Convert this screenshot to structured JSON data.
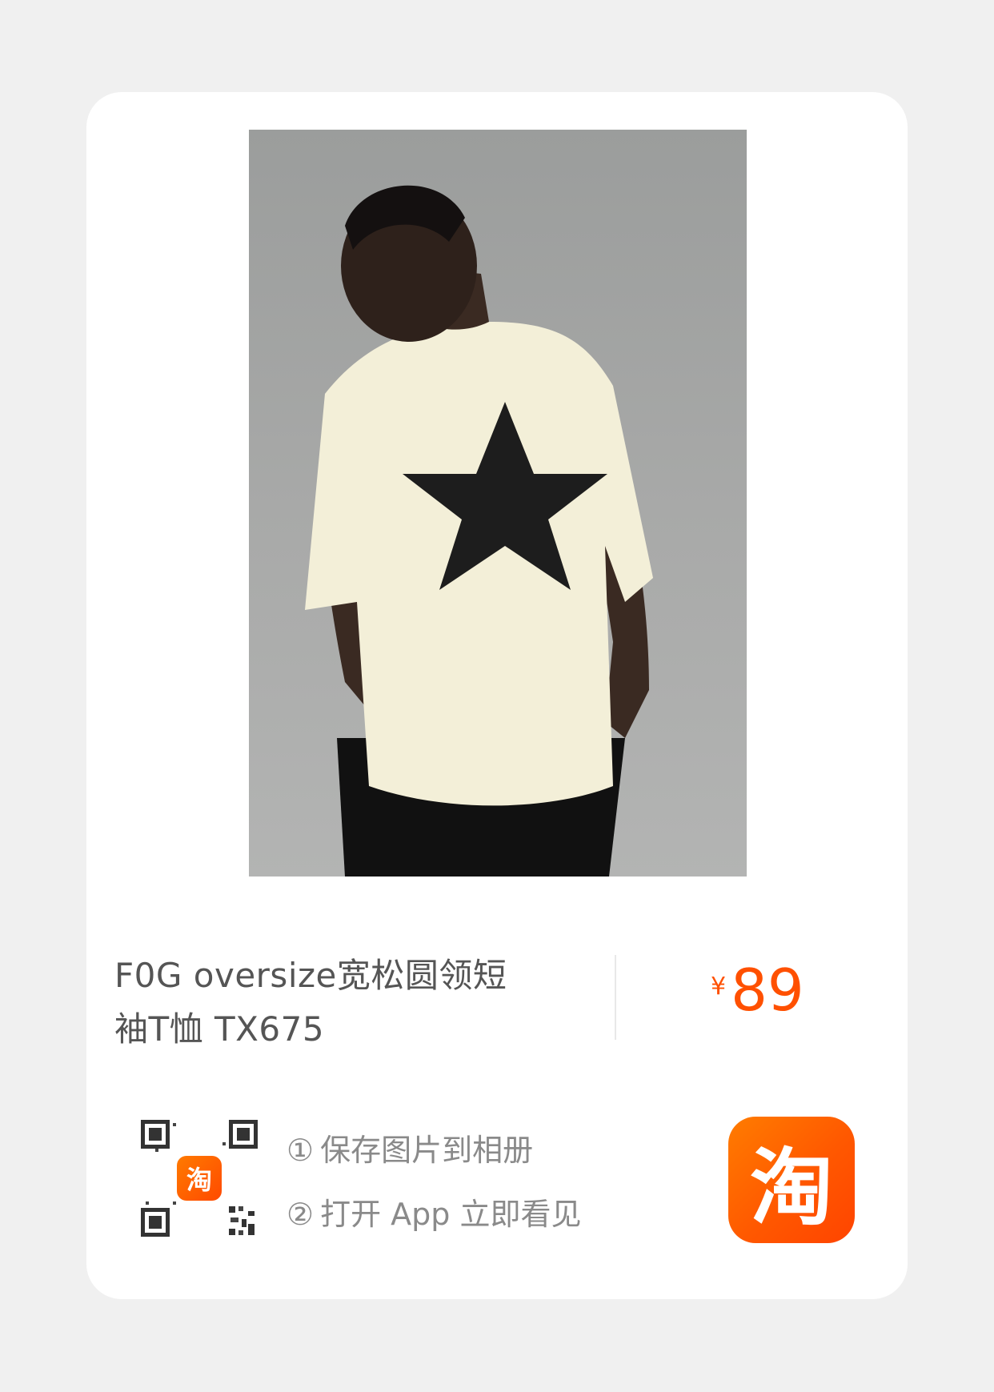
{
  "product": {
    "title_line1": "F0G oversize宽松圆领短",
    "title_line2": "袖T恤 TX675",
    "currency": "¥",
    "price": "89"
  },
  "instructions": {
    "step1_num": "①",
    "step1_text": "保存图片到相册",
    "step2_num": "②",
    "step2_text": "打开 App 立即看见"
  },
  "qr_logo_text": "淘",
  "app_icon_text": "淘",
  "colors": {
    "price_accent": "#ff5000",
    "app_brand": "#ff5800",
    "background": "#f0f0f0"
  }
}
